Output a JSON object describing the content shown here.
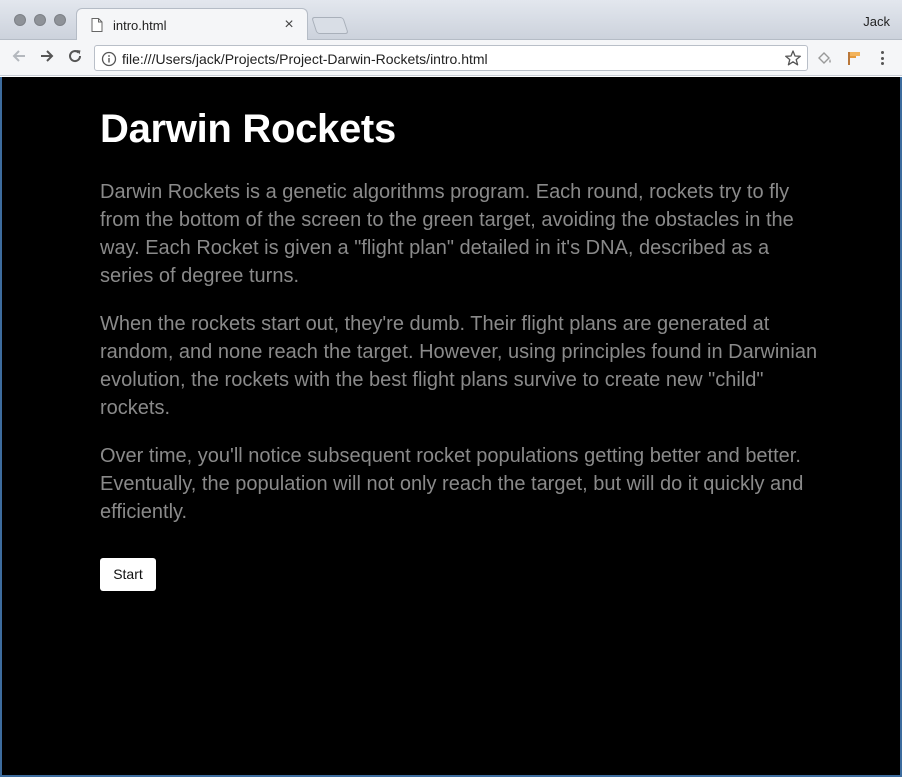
{
  "browser": {
    "tab": {
      "title": "intro.html",
      "icon": "file-icon",
      "close_icon": "close-icon",
      "close_glyph": "×"
    },
    "profile_name": "Jack",
    "address_bar": {
      "url": "file:///Users/jack/Projects/Project-Darwin-Rockets/intro.html",
      "info_icon": "info-icon",
      "bookmark_icon": "star-icon"
    },
    "nav": {
      "back_icon": "arrow-left-icon",
      "forward_icon": "arrow-right-icon",
      "reload_icon": "reload-icon"
    },
    "extensions": [
      "paint-bucket-icon",
      "flag-icon"
    ],
    "menu_icon": "three-dots-vertical-icon"
  },
  "page": {
    "title": "Darwin Rockets",
    "paragraphs": [
      "Darwin Rockets is a genetic algorithms program. Each round, rockets try to fly from the bottom of the screen to the green target, avoiding the obstacles in the way. Each Rocket is given a \"flight plan\" detailed in it's DNA, described as a series of degree turns.",
      "When the rockets start out, they're dumb. Their flight plans are generated at random, and none reach the target. However, using principles found in Darwinian evolution, the rockets with the best flight plans survive to create new \"child\" rockets.",
      "Over time, you'll notice subsequent rocket populations getting better and better. Eventually, the population will not only reach the target, but will do it quickly and efficiently."
    ],
    "start_button": "Start"
  },
  "colors": {
    "page_background": "#000000",
    "title": "#ffffff",
    "body_text": "#8a8a8a",
    "button_background": "#ffffff"
  }
}
